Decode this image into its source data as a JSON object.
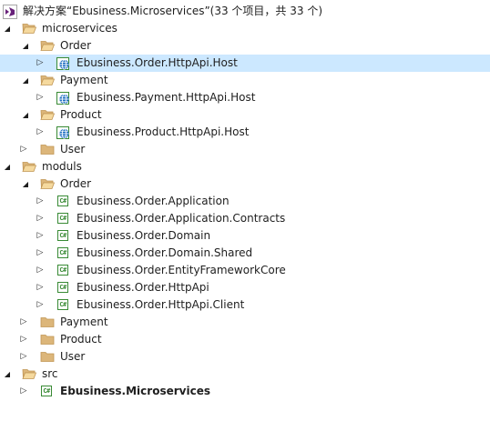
{
  "solution": {
    "label": "解决方案“Ebusiness.Microservices”(33 个项目，共 33 个)"
  },
  "nodes": [
    {
      "label": "microservices"
    },
    {
      "label": "Order"
    },
    {
      "label": "Ebusiness.Order.HttpApi.Host"
    },
    {
      "label": "Payment"
    },
    {
      "label": "Ebusiness.Payment.HttpApi.Host"
    },
    {
      "label": "Product"
    },
    {
      "label": "Ebusiness.Product.HttpApi.Host"
    },
    {
      "label": "User"
    },
    {
      "label": "moduls"
    },
    {
      "label": "Order"
    },
    {
      "label": "Ebusiness.Order.Application"
    },
    {
      "label": "Ebusiness.Order.Application.Contracts"
    },
    {
      "label": "Ebusiness.Order.Domain"
    },
    {
      "label": "Ebusiness.Order.Domain.Shared"
    },
    {
      "label": "Ebusiness.Order.EntityFrameworkCore"
    },
    {
      "label": "Ebusiness.Order.HttpApi"
    },
    {
      "label": "Ebusiness.Order.HttpApi.Client"
    },
    {
      "label": "Payment"
    },
    {
      "label": "Product"
    },
    {
      "label": "User"
    },
    {
      "label": "src"
    },
    {
      "label": "Ebusiness.Microservices"
    }
  ],
  "icons": {
    "csharp_text": "C#"
  },
  "colors": {
    "selection": "#cce8ff",
    "folder": "#dcb67a",
    "csharp": "#388a34",
    "web": "#1e6fc2",
    "solution": "#68217a"
  }
}
